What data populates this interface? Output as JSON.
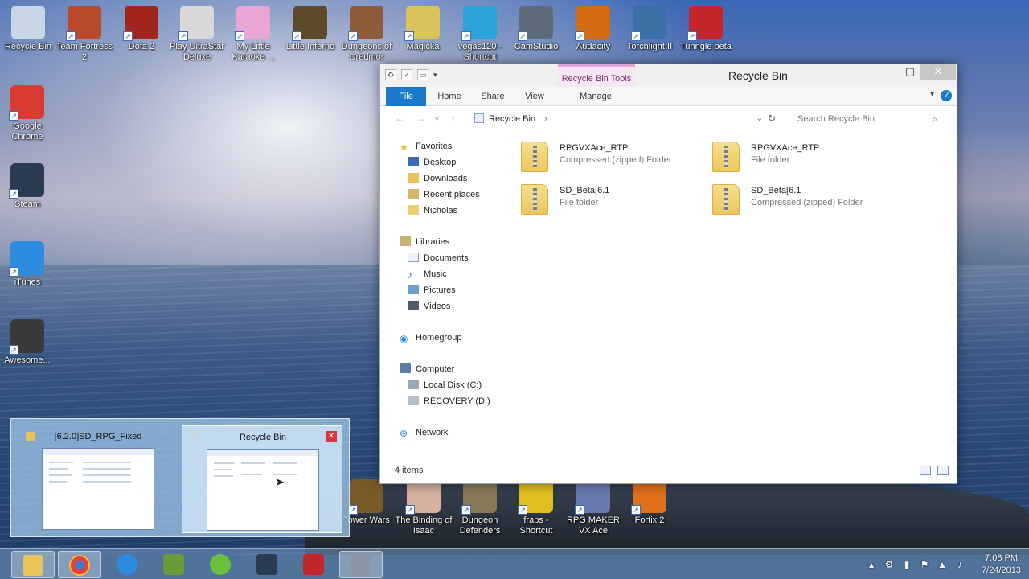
{
  "desktop": {
    "icons_top": [
      {
        "label": "Recycle Bin",
        "color": "#c9d6e6"
      },
      {
        "label": "Team Fortress 2",
        "color": "#b94a2a"
      },
      {
        "label": "Dota 2",
        "color": "#a3261d"
      },
      {
        "label": "Play UltraStar Deluxe",
        "color": "#d8d8d8"
      },
      {
        "label": "My Little Karaoke ...",
        "color": "#e9a5d3"
      },
      {
        "label": "Little Inferno",
        "color": "#5e4a2a"
      },
      {
        "label": "Dungeons of Dredmor",
        "color": "#8f5c3a"
      },
      {
        "label": "Magicka",
        "color": "#d9c35a"
      },
      {
        "label": "vegas120 - Shortcut",
        "color": "#2aa3d8"
      },
      {
        "label": "CamStudio",
        "color": "#5d6b7a"
      },
      {
        "label": "Audacity",
        "color": "#d46c12"
      },
      {
        "label": "Torchlight II",
        "color": "#3b6fa5"
      },
      {
        "label": "Tunngle beta",
        "color": "#c3262a"
      }
    ],
    "icons_left": [
      {
        "label": "Google Chrome",
        "color": "#d93c30"
      },
      {
        "label": "Steam",
        "color": "#2a3b52"
      },
      {
        "label": "iTunes",
        "color": "#2d8be0"
      },
      {
        "label": "Awesome...",
        "color": "#3a3a3a"
      }
    ],
    "icons_bottom": [
      {
        "label": "Tower Wars",
        "color": "#7b5a2a"
      },
      {
        "label": "The Binding of Isaac",
        "color": "#d8b0a0"
      },
      {
        "label": "Dungeon Defenders",
        "color": "#8a7a5a"
      },
      {
        "label": "fraps - Shortcut",
        "color": "#e0c020"
      },
      {
        "label": "RPG MAKER VX Ace",
        "color": "#6a7ab0"
      },
      {
        "label": "Fortix 2",
        "color": "#e0701a"
      }
    ]
  },
  "explorer": {
    "title": "Recycle Bin",
    "context_tab": "Recycle Bin Tools",
    "ribbon_tabs": {
      "file": "File",
      "home": "Home",
      "share": "Share",
      "view": "View",
      "manage": "Manage"
    },
    "address": {
      "location": "Recycle Bin",
      "search_placeholder": "Search Recycle Bin"
    },
    "nav": {
      "favorites": "Favorites",
      "desktop": "Desktop",
      "downloads": "Downloads",
      "recent": "Recent places",
      "nicholas": "Nicholas",
      "libraries": "Libraries",
      "documents": "Documents",
      "music": "Music",
      "pictures": "Pictures",
      "videos": "Videos",
      "homegroup": "Homegroup",
      "computer": "Computer",
      "local_disk": "Local Disk (C:)",
      "recovery": "RECOVERY (D:)",
      "network": "Network"
    },
    "files": [
      {
        "name": "RPGVXAce_RTP",
        "type": "Compressed (zipped) Folder",
        "zip": true
      },
      {
        "name": "RPGVXAce_RTP",
        "type": "File folder",
        "zip": true
      },
      {
        "name": "SD_Beta[6.1",
        "type": "File folder",
        "zip": true
      },
      {
        "name": "SD_Beta[6.1",
        "type": "Compressed (zipped) Folder",
        "zip": true
      }
    ],
    "status": "4 items"
  },
  "thumbnails": {
    "left_title": "[6.2.0]SD_RPG_Fixed",
    "right_title": "Recycle Bin",
    "close": "✕"
  },
  "taskbar": {
    "clock_time": "7:08 PM",
    "clock_date": "7/24/2013"
  },
  "colors": {
    "accent": "#1979ca",
    "context_tab": "#f7e6f5"
  }
}
